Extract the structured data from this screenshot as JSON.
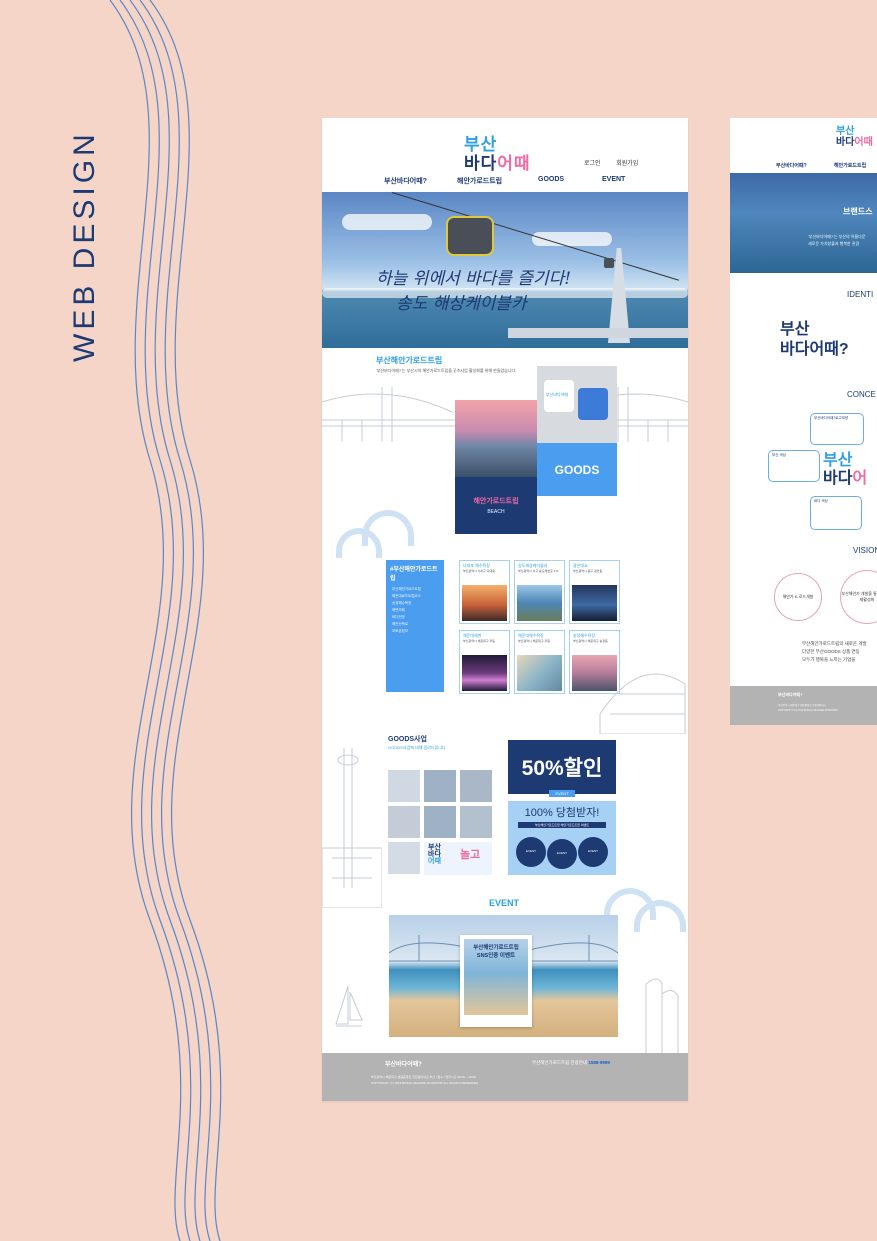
{
  "side_title": "WEB DESIGN",
  "colors": {
    "background": "#f4d5c7",
    "navy": "#1d3a73",
    "sky": "#2e9fe3",
    "pink": "#f06aa6",
    "footer": "#b3b3b3"
  },
  "main": {
    "logo": {
      "line1": "부산",
      "line2a": "바다",
      "line2b": "어때"
    },
    "toplinks": [
      "로그인",
      "회원가입"
    ],
    "nav": [
      "부산바다어때?",
      "해안가로드트립",
      "GOODS",
      "EVENT"
    ],
    "hero": {
      "line1": "하늘 위에서 바다를 즐기다!",
      "line2": "송도 해상케이블카"
    },
    "intro": {
      "title": "부산해안가로드트립",
      "desc": "'부산바다어때?'는 부산시의 해안가로드트립을 굿즈사업 활성화를 위해 만들었습니다."
    },
    "tiles": {
      "goods": "GOODS",
      "roadtrip": "해안가로드트립",
      "beach": "BEACH",
      "mug_logo": "부산바다어때"
    },
    "sidebar": {
      "heading": "#부산해안가로드트립",
      "items": [
        "부산해안가로드트립",
        "해운대로드트립코스",
        "송정해수욕장",
        "해변카페",
        "바다전망",
        "해안산책로",
        "포토존정보"
      ]
    },
    "cards": [
      {
        "title": "다대포 해수욕장",
        "desc": "부산광역시 사하구 다대동"
      },
      {
        "title": "송도해상케이블카",
        "desc": "부산광역시 서구 송도해변로 171"
      },
      {
        "title": "광안대교",
        "desc": "부산광역시 중구 광안동"
      },
      {
        "title": "해운대해변",
        "desc": "부산광역시 해운대구 우동"
      },
      {
        "title": "해운대해수욕장",
        "desc": "부산광역시 해운대구 우동"
      },
      {
        "title": "송정해수욕장",
        "desc": "부산광역시 해운대구 송정동"
      }
    ],
    "goods": {
      "title": "GOODS사업",
      "desc": "GOODS사업에 대해 알려드립니다"
    },
    "promo": {
      "line1": "부산",
      "line2": "바다",
      "line3": "어때",
      "play": "놀고"
    },
    "sale": {
      "percent": "50%할인",
      "tag": "EVENT"
    },
    "win": {
      "title": "100% 당첨받자!",
      "bar": "부산해안가로드트립 해안가로드트립 이벤트",
      "dots": [
        "EVENT",
        "EVENT",
        "EVENT"
      ]
    },
    "event": {
      "title": "EVENT",
      "card_title1": "부산해안가로드트립",
      "card_title2": "SNS인증 이벤트"
    },
    "footer": {
      "name": "부산바다어때?",
      "contact_label": "부산해안가로드트립 관광안내",
      "contact_number": "1588-9999",
      "address": "부산광역시 해운대구 센텀중앙로 전관광안내소 부산 | 접수 / 업무시간 09:00 ~ 18:00",
      "copyright": "COPYRIGHT (C) 2019 BUSAN SEASIDE ROADTRIP ALL RIGHTS RESERVED."
    }
  },
  "second": {
    "logo": {
      "line1": "부산",
      "line2a": "바다",
      "line2b": "어때"
    },
    "nav": [
      "부산바다어때?",
      "해안가로드트립"
    ],
    "hero": {
      "title": "브랜드스",
      "desc1": "'부산바다어때?'는 부산의 아름다운",
      "desc2": "새로운 가치창출과 행복한 관광"
    },
    "sections": [
      "IDENTI",
      "CONCE",
      "VISION"
    ],
    "identity": {
      "line1": "부산",
      "line2": "바다어때?"
    },
    "concept_bubbles": [
      "부산바다어때?로고모양",
      "부산 색상",
      "바다 색상"
    ],
    "concept_logo": {
      "line1": "부산",
      "line2a": "바다",
      "line2b": "어"
    },
    "vision": [
      "해안가 K-로드개발",
      "부산해안가 개발을 통한 지역경제활성화"
    ],
    "text1": "부산해안가로드트립의 새로운 개발",
    "text2": "다양한 부산GOODS 상품 연동",
    "text3": "모두가 행복을 느끼는 기업을",
    "footer": {
      "name": "부산바다어때?",
      "address": "부산광역시 해운대구 센텀중앙로 전관광안내소",
      "copyright": "COPYRIGHT (C) 2019 BUSAN SEASIDE ROADTRIP"
    }
  }
}
